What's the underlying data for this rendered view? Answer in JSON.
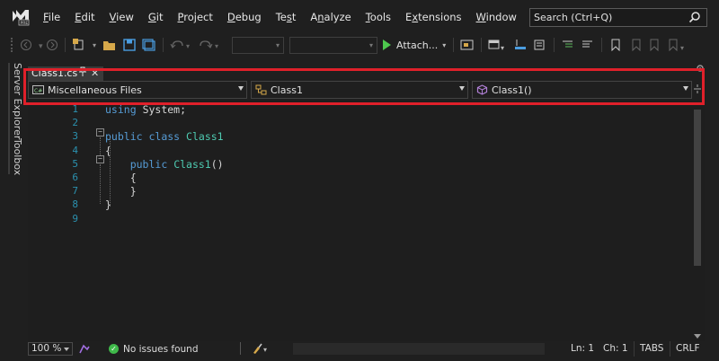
{
  "menu": {
    "items": [
      {
        "label": "File",
        "mnemonic": "F"
      },
      {
        "label": "Edit",
        "mnemonic": "E"
      },
      {
        "label": "View",
        "mnemonic": "V"
      },
      {
        "label": "Git",
        "mnemonic": "G"
      },
      {
        "label": "Project",
        "mnemonic": "P"
      },
      {
        "label": "Debug",
        "mnemonic": "D"
      },
      {
        "label": "Test",
        "mnemonic": "s"
      },
      {
        "label": "Analyze",
        "mnemonic": "n"
      },
      {
        "label": "Tools",
        "mnemonic": "T"
      },
      {
        "label": "Extensions",
        "mnemonic": "x"
      },
      {
        "label": "Window",
        "mnemonic": "W"
      },
      {
        "label": "Help",
        "mnemonic": "H"
      }
    ],
    "search_placeholder": "Search (Ctrl+Q)"
  },
  "toolbar": {
    "attach_label": "Attach..."
  },
  "sidebar": {
    "server_explorer": "Server Explorer",
    "toolbox": "Toolbox"
  },
  "document": {
    "tab_title": "Class1.cs",
    "pin_icon": "pin-icon",
    "close_glyph": "✕"
  },
  "navbar": {
    "project": "Miscellaneous Files",
    "type": "Class1",
    "member": "Class1()"
  },
  "editor": {
    "line_numbers": [
      "1",
      "2",
      "3",
      "4",
      "5",
      "6",
      "7",
      "8",
      "9"
    ],
    "lines": [
      "using System;",
      "",
      "public class Class1",
      "{",
      "    public Class1()",
      "    {",
      "    }",
      "}",
      ""
    ]
  },
  "status": {
    "zoom": "100 %",
    "issues": "No issues found",
    "line": "Ln: 1",
    "col": "Ch: 1",
    "tabs": "TABS",
    "eol": "CRLF"
  },
  "colors": {
    "highlight": "#e0202a",
    "keyword": "#569cd6",
    "type": "#4ec9b0",
    "line_number": "#2b91af"
  }
}
